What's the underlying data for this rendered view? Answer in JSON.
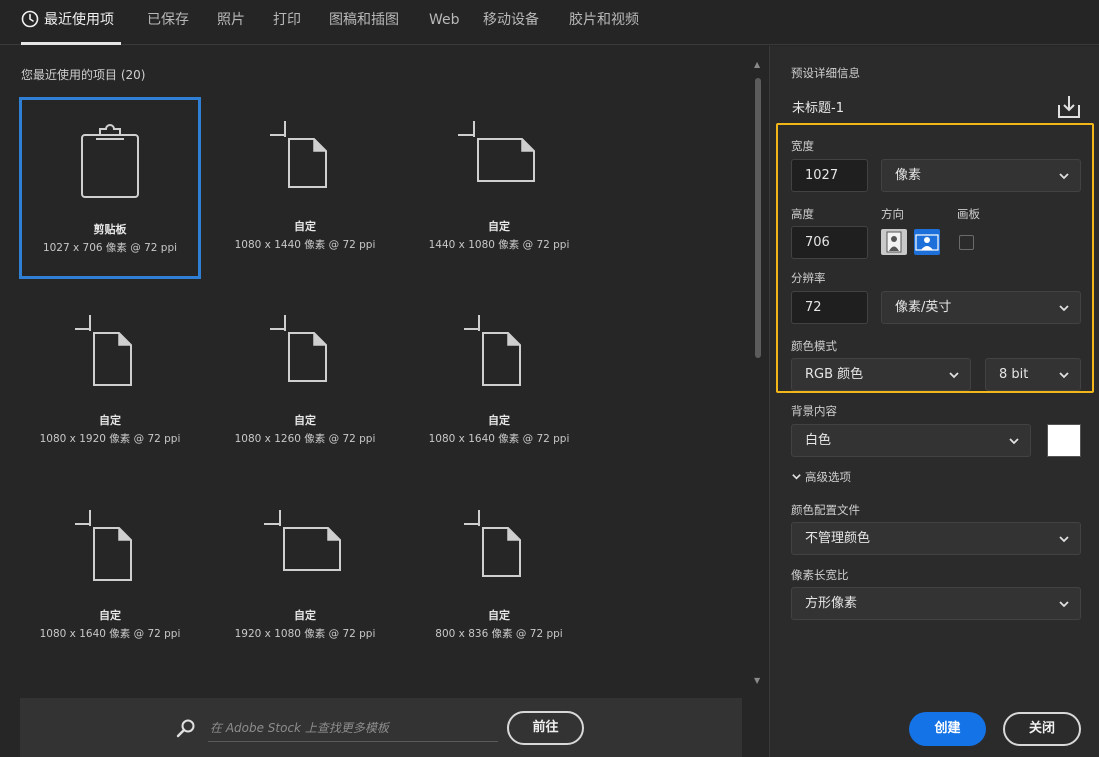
{
  "tabs": [
    {
      "label": "最近使用项",
      "active": true
    },
    {
      "label": "已保存"
    },
    {
      "label": "照片"
    },
    {
      "label": "打印"
    },
    {
      "label": "图稿和插图"
    },
    {
      "label": "Web"
    },
    {
      "label": "移动设备"
    },
    {
      "label": "胶片和视频"
    }
  ],
  "recent": {
    "title": "您最近使用的项目 (20)",
    "items": [
      {
        "name": "剪贴板",
        "dims": "1027 x 706 像素 @ 72 ppi",
        "icon": "clipboard-icon"
      },
      {
        "name": "自定",
        "dims": "1080 x 1440 像素 @ 72 ppi",
        "icon": "document-portrait-icon"
      },
      {
        "name": "自定",
        "dims": "1440 x 1080 像素 @ 72 ppi",
        "icon": "document-landscape-icon"
      },
      {
        "name": "自定",
        "dims": "1080 x 1920 像素 @ 72 ppi",
        "icon": "document-portrait-icon"
      },
      {
        "name": "自定",
        "dims": "1080 x 1260 像素 @ 72 ppi",
        "icon": "document-portrait-icon"
      },
      {
        "name": "自定",
        "dims": "1080 x 1640 像素 @ 72 ppi",
        "icon": "document-portrait-icon"
      },
      {
        "name": "自定",
        "dims": "1080 x 1640 像素 @ 72 ppi",
        "icon": "document-portrait-icon"
      },
      {
        "name": "自定",
        "dims": "1920 x 1080 像素 @ 72 ppi",
        "icon": "document-landscape-icon"
      },
      {
        "name": "自定",
        "dims": "800 x 836 像素 @ 72 ppi",
        "icon": "document-portrait-icon"
      }
    ]
  },
  "search": {
    "placeholder": "在 Adobe Stock 上查找更多模板",
    "go_label": "前往"
  },
  "preset": {
    "section_label": "预设详细信息",
    "doc_name": "未标题-1",
    "width_label": "宽度",
    "width_value": "1027",
    "width_unit": "像素",
    "height_label": "高度",
    "height_value": "706",
    "orientation_label": "方向",
    "artboard_label": "画板",
    "resolution_label": "分辨率",
    "resolution_value": "72",
    "resolution_unit": "像素/英寸",
    "color_mode_label": "颜色模式",
    "color_mode_value": "RGB 颜色",
    "bit_depth_value": "8 bit",
    "background_label": "背景内容",
    "background_value": "白色",
    "background_color": "#ffffff",
    "advanced_label": "高级选项",
    "color_profile_label": "颜色配置文件",
    "color_profile_value": "不管理颜色",
    "pixel_aspect_label": "像素长宽比",
    "pixel_aspect_value": "方形像素"
  },
  "actions": {
    "create_label": "创建",
    "close_label": "关闭"
  },
  "colors": {
    "accent": "#1473e6",
    "selection": "#2f7fd4",
    "highlight": "#f2b619"
  }
}
